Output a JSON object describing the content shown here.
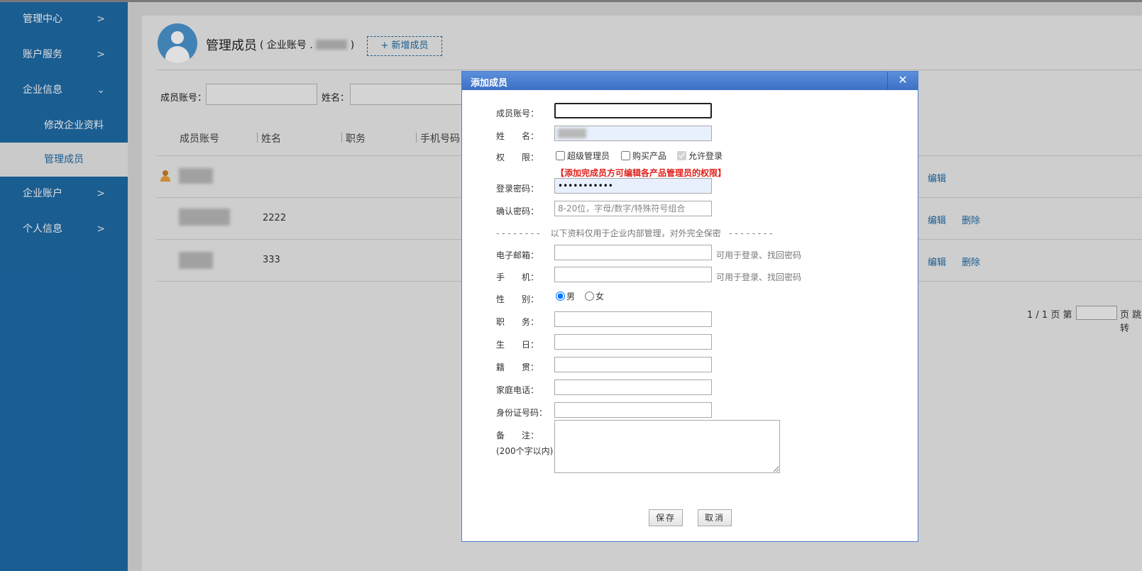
{
  "sidebar": {
    "items": [
      {
        "label": "管理中心",
        "chevron": ">"
      },
      {
        "label": "账户服务",
        "chevron": ">"
      },
      {
        "label": "企业信息",
        "chevron": "⌄"
      },
      {
        "label": "修改企业资料"
      },
      {
        "label": "管理成员"
      },
      {
        "label": "企业账户",
        "chevron": ">"
      },
      {
        "label": "个人信息",
        "chevron": ">"
      }
    ]
  },
  "page": {
    "title": "管理成员",
    "account_prefix": "( 企业账号 .",
    "account_suffix": ")",
    "add_button": "+ 新增成员",
    "filter_account_label": "成员账号：",
    "filter_name_label": "姓名：",
    "columns": [
      "成员账号",
      "姓名",
      "职务",
      "手机号码"
    ],
    "rows": [
      {
        "name": "",
        "edit": "编辑",
        "delete": ""
      },
      {
        "name": "2222",
        "edit": "编辑",
        "delete": "删除"
      },
      {
        "name": "333",
        "edit": "编辑",
        "delete": "删除"
      }
    ],
    "pager": "1 / 1  页 第",
    "pager_after": "页 跳转"
  },
  "dialog": {
    "title": "添加成员",
    "close": "✕",
    "fields": {
      "account_label": "成员账号：",
      "name_label": "姓　　名：",
      "permission_label": "权　　限：",
      "perm_super": "超级管理员",
      "perm_buy": "购买产品",
      "perm_login": "允许登录",
      "notice": "【添加完成员方可编辑各产品管理员的权限】",
      "password_label": "登录密码：",
      "password_value": "•••••••••••",
      "confirm_label": "确认密码：",
      "confirm_placeholder": "8-20位，字母/数字/特殊符号组合",
      "divider": "- - - - - - - -    以下资料仅用于企业内部管理，对外完全保密   - - - - - - - -",
      "email_label": "电子邮箱：",
      "email_hint": "可用于登录、找回密码",
      "mobile_label": "手　　机：",
      "mobile_hint": "可用于登录、找回密码",
      "gender_label": "性　　别：",
      "gender_male": "男",
      "gender_female": "女",
      "job_label": "职　　务：",
      "birthday_label": "生　　日：",
      "hometown_label": "籍　　贯：",
      "home_phone_label": "家庭电话：",
      "id_label": "身份证号码：",
      "remark_label": "备　　注：",
      "remark_hint": "(200个字以内)"
    },
    "save_button": "保存",
    "cancel_button": "取消"
  }
}
